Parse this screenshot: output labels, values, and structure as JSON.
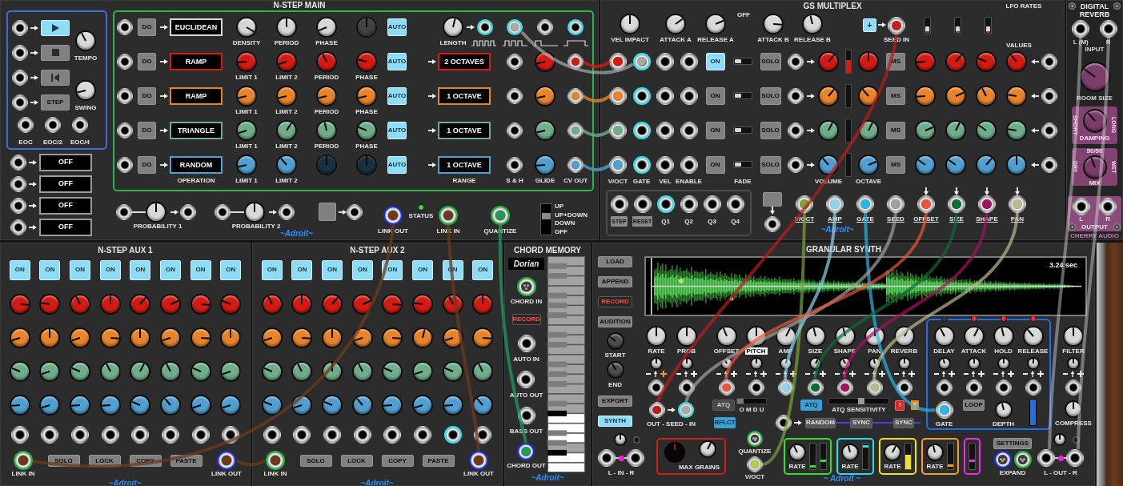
{
  "nstep_main": {
    "title": "N-STEP MAIN",
    "transport": [
      {
        "kind": "play",
        "on": true
      },
      {
        "kind": "stop",
        "on": false
      },
      {
        "kind": "rewind",
        "on": false
      },
      {
        "kind": "step",
        "label": "STEP",
        "on": false
      }
    ],
    "tempo": {
      "label": "TEMPO",
      "level": 0.4
    },
    "swing": {
      "label": "SWING",
      "level": 0.12
    },
    "clock_outputs": [
      {
        "label": "EOC"
      },
      {
        "label": "EOC/2"
      },
      {
        "label": "EOC/4"
      }
    ],
    "mode_displays": [
      {
        "value": "OFF"
      },
      {
        "value": "OFF"
      },
      {
        "value": "OFF"
      },
      {
        "value": "OFF"
      }
    ],
    "rows": [
      {
        "color": "#d6d6d6",
        "do": "DO",
        "operation": "EUCLIDEAN",
        "knobs": [
          {
            "label": "DENSITY",
            "level": 0.95,
            "disabled": false
          },
          {
            "label": "PERIOD",
            "level": 0.5,
            "disabled": false
          },
          {
            "label": "PHASE",
            "level": 0.08,
            "disabled": false
          },
          {
            "level": 0.5,
            "disabled": true
          }
        ],
        "auto": {
          "label": "AUTO",
          "on": true
        }
      },
      {
        "color": "#d41a12",
        "do": "DO",
        "operation": "RAMP",
        "knobs": [
          {
            "label": "LIMIT 1",
            "level": 0.15,
            "disabled": false
          },
          {
            "label": "LIMIT 2",
            "level": 0.1,
            "disabled": false
          },
          {
            "label": "PERIOD",
            "level": 0.4,
            "disabled": false
          },
          {
            "label": "PHASE",
            "level": 0.22,
            "disabled": false
          }
        ],
        "auto": {
          "label": "AUTO",
          "on": true
        },
        "range": "2 OCTAVES",
        "glide": {
          "level": 0.12
        },
        "cv_out": {
          "plugged": true
        }
      },
      {
        "color": "#e8832a",
        "do": "DO",
        "operation": "RAMP",
        "knobs": [
          {
            "label": "LIMIT 1",
            "level": 0.12,
            "disabled": false
          },
          {
            "label": "LIMIT 2",
            "level": 0.12,
            "disabled": false
          },
          {
            "label": "PERIOD",
            "level": 0.12,
            "disabled": false
          },
          {
            "label": "PHASE",
            "level": 0.12,
            "disabled": false
          }
        ],
        "auto": {
          "label": "AUTO",
          "on": true
        },
        "range": "1 OCTAVE",
        "glide": {
          "level": 0.12
        },
        "cv_out": {
          "plugged": true
        }
      },
      {
        "color": "#6fae8a",
        "do": "DO",
        "operation": "TRIANGLE",
        "knobs": [
          {
            "label": "LIMIT 1",
            "level": 0.1,
            "disabled": false
          },
          {
            "label": "LIMIT 2",
            "level": 0.62,
            "disabled": false
          },
          {
            "label": "PERIOD",
            "level": 0.45,
            "disabled": false
          },
          {
            "label": "PHASE",
            "level": 0.25,
            "disabled": false
          }
        ],
        "auto": {
          "label": "AUTO",
          "on": true
        },
        "range": "1 OCTAVE",
        "glide": {
          "level": 0.12
        },
        "cv_out": {
          "plugged": true
        }
      },
      {
        "color": "#4f9fd0",
        "do": "DO",
        "operation": "RANDOM",
        "knobs": [
          {
            "label": "LIMIT 1",
            "level": 0.12,
            "disabled": false
          },
          {
            "label": "LIMIT 2",
            "level": 0.35,
            "disabled": false
          },
          {
            "level": 0.5,
            "disabled": true
          },
          {
            "level": 0.5,
            "disabled": true
          }
        ],
        "auto": {
          "label": "AUTO",
          "on": true
        },
        "range": "1 OCTAVE",
        "glide": {
          "level": 0.15
        },
        "cv_out": {
          "plugged": true
        }
      }
    ],
    "length": {
      "label": "LENGTH",
      "level": 0.55
    },
    "gate_outputs": [
      {
        "highlighted": true
      },
      {
        "highlighted": true,
        "plug": {
          "color": "#a9a9a9"
        }
      },
      {
        "highlighted": false
      },
      {
        "highlighted": true
      }
    ],
    "column_labels": {
      "operation": "OPERATION",
      "range": "RANGE",
      "sample_hold": "S & H",
      "glide": "GLIDE",
      "cv_out": "CV OUT"
    },
    "probability": [
      {
        "label": "PROBABILITY 1",
        "level": 0.5
      },
      {
        "label": "PROBABILITY 2",
        "level": 0.5
      }
    ],
    "link_out": {
      "label": "LINK OUT",
      "color": "#1d2ed8",
      "plug": {
        "color": "#6b3a1c"
      }
    },
    "status": {
      "label": "STATUS",
      "on": true
    },
    "link_in": {
      "label": "LINK IN",
      "color": "#1fb53a",
      "plug": {
        "color": "#6b3a1c"
      }
    },
    "quantize": {
      "label": "QUANTIZE",
      "color": "#1fb53a",
      "plug": {
        "color": "#1f9a5a"
      }
    },
    "direction": [
      {
        "label": "UP",
        "selected": false
      },
      {
        "label": "UP+DOWN",
        "selected": true
      },
      {
        "label": "DOWN",
        "selected": false
      },
      {
        "label": "OFF",
        "selected": false
      }
    ],
    "logo": "~Adroit~"
  },
  "gs_multiplex": {
    "title": "GS MULTIPLEX",
    "top_knobs": [
      {
        "label": "VEL IMPACT",
        "level": 0.5
      },
      {
        "label": "ATTACK A",
        "level": 0.7
      },
      {
        "label": "RELEASE A",
        "level": 0.75
      }
    ],
    "fade_label": "OFF",
    "top_knobs_b": [
      {
        "label": "ATTACK B",
        "level": 0.85
      },
      {
        "label": "RELEASE B",
        "level": 0.45
      }
    ],
    "seed_button": {
      "label": "+",
      "on": true
    },
    "seed_in": {
      "label": "SEED IN",
      "plug": {
        "color": "#c42020"
      }
    },
    "lfo_rates_label": "LFO RATES",
    "values_label": "VALUES",
    "lfo_switches": [
      {
        "on": false
      },
      {
        "on": false
      },
      {
        "on": false
      }
    ],
    "rows": [
      {
        "color": "#d41a12",
        "voct": {
          "plugged": true
        },
        "gate": {
          "highlighted": true,
          "plug": {
            "color": "#a9a9a9"
          }
        },
        "on_button": {
          "label": "ON",
          "on": true
        },
        "fade": {
          "on": false
        },
        "solo": "SOLO",
        "volume": {
          "level": 0.65
        },
        "meter": {
          "level": 0.55
        },
        "octave": {
          "level": 0.5
        },
        "ms": "MS",
        "knobs": [
          {
            "level": 0.15
          },
          {
            "level": 0.65
          },
          {
            "level": 0.25
          },
          {
            "level": 0.35
          }
        ]
      },
      {
        "color": "#e8832a",
        "voct": {
          "plugged": true
        },
        "gate": {
          "highlighted": true
        },
        "on_button": {
          "label": "ON",
          "on": false
        },
        "fade": {
          "on": false
        },
        "solo": "SOLO",
        "volume": {
          "level": 0.65
        },
        "octave": {
          "level": 0.35
        },
        "ms": "MS",
        "knobs": [
          {
            "level": 0.15
          },
          {
            "level": 0.75
          },
          {
            "level": 0.4
          },
          {
            "level": 0.2
          }
        ]
      },
      {
        "color": "#6fae8a",
        "voct": {
          "plugged": true
        },
        "gate": {
          "highlighted": true
        },
        "on_button": {
          "label": "ON",
          "on": false
        },
        "fade": {
          "on": false
        },
        "solo": "SOLO",
        "volume": {
          "level": 0.6
        },
        "octave": {
          "level": 0.6
        },
        "ms": "MS",
        "knobs": [
          {
            "level": 0.75
          },
          {
            "level": 0.6
          },
          {
            "level": 0.3
          },
          {
            "level": 0.2
          }
        ]
      },
      {
        "color": "#4f9fd0",
        "voct": {
          "plugged": true
        },
        "gate": {
          "highlighted": true
        },
        "on_button": {
          "label": "ON",
          "on": false
        },
        "fade": {
          "on": false
        },
        "solo": "SOLO",
        "volume": {
          "level": 0.35
        },
        "octave": {
          "level": 0.75
        },
        "ms": "MS",
        "knobs": [
          {
            "level": 0.3
          },
          {
            "level": 0.3
          },
          {
            "level": 0.65
          },
          {
            "level": 0.5
          }
        ]
      }
    ],
    "column_labels": {
      "voct": "V/OCT",
      "gate": "GATE",
      "vel": "VEL",
      "enable": "ENABLE",
      "fade": "FADE",
      "volume": "VOLUME",
      "octave": "OCTAVE"
    },
    "clock_inputs": [
      {
        "label": "STEP",
        "kind": "boxed",
        "highlighted": false
      },
      {
        "label": "RESET",
        "kind": "boxed",
        "highlighted": false
      },
      {
        "label": "Q1",
        "kind": "plain",
        "highlighted": true
      },
      {
        "label": "Q2",
        "kind": "plain",
        "highlighted": false
      },
      {
        "label": "Q3",
        "kind": "plain",
        "highlighted": false
      },
      {
        "label": "Q4",
        "kind": "plain",
        "highlighted": false
      }
    ],
    "outputs": [
      {
        "label": "V/OCT",
        "plug": {
          "color": "#7ea23a"
        }
      },
      {
        "label": "AMP",
        "plug": {
          "color": "#8fd3ef"
        }
      },
      {
        "label": "GATE",
        "plug": {
          "color": "#29b6e8"
        }
      },
      {
        "label": "SEED",
        "plug": {
          "color": "#a0a0a0"
        }
      },
      {
        "label": "OFFSET",
        "plug": {
          "color": "#e8553a"
        }
      },
      {
        "label": "SIZE",
        "plug": {
          "color": "#0d6b35"
        }
      },
      {
        "label": "SHAPE",
        "plug": {
          "color": "#a3125f"
        }
      },
      {
        "label": "PAN",
        "plug": {
          "color": "#bdb98f"
        }
      }
    ],
    "logo": "~Adroit~"
  },
  "digital_reverb": {
    "title": "DIGITAL REVERB",
    "inputs": [
      {
        "label": "L (M)"
      },
      {
        "label": "R"
      }
    ],
    "input_label": "INPUT",
    "room_size": {
      "label": "ROOM SIZE",
      "level": 0.3
    },
    "damping": {
      "label": "DAMPING",
      "low": "SHORT",
      "high": "LONG",
      "level": 0.35
    },
    "mix": {
      "center": "50/50",
      "label": "MIX",
      "low": "DRY",
      "high": "WET",
      "level": 0.42
    },
    "outputs": [
      {
        "label": "L"
      },
      {
        "label": "R"
      }
    ],
    "output_label": "OUTPUT",
    "brand": "CHERRY AUDIO"
  },
  "aux": [
    {
      "title": "N-STEP AUX 1",
      "on_buttons": [
        {
          "label": "ON",
          "on": true
        },
        {
          "label": "ON",
          "on": true
        },
        {
          "label": "ON",
          "on": true
        },
        {
          "label": "ON",
          "on": true
        },
        {
          "label": "ON",
          "on": true
        },
        {
          "label": "ON",
          "on": true
        },
        {
          "label": "ON",
          "on": true
        },
        {
          "label": "ON",
          "on": true
        }
      ],
      "knob_rows": [
        {
          "color": "#d41a12",
          "knobs": [
            {
              "level": 0.85
            },
            {
              "level": 0.2
            },
            {
              "level": 0.4
            },
            {
              "level": 0.5
            },
            {
              "level": 0.65
            },
            {
              "level": 0.75
            },
            {
              "level": 0.85
            },
            {
              "level": 0.25
            }
          ]
        },
        {
          "color": "#e8832a",
          "knobs": [
            {
              "level": 0.1
            },
            {
              "level": 0.5
            },
            {
              "level": 0.1
            },
            {
              "level": 0.85
            },
            {
              "level": 0.5
            },
            {
              "level": 0.1
            },
            {
              "level": 0.85
            },
            {
              "level": 0.5
            }
          ]
        },
        {
          "color": "#6fae8a",
          "knobs": [
            {
              "level": 0.25
            },
            {
              "level": 0.1
            },
            {
              "level": 0.25
            },
            {
              "level": 0.4
            },
            {
              "level": 0.6
            },
            {
              "level": 0.4
            },
            {
              "level": 0.25
            },
            {
              "level": 0.1
            }
          ]
        },
        {
          "color": "#4f9fd0",
          "knobs": [
            {
              "level": 0.15
            },
            {
              "level": 0.1
            },
            {
              "level": 0.15
            },
            {
              "level": 0.15
            },
            {
              "level": 0.25
            },
            {
              "level": 0.35
            },
            {
              "level": 0.1
            },
            {
              "level": 0.1
            }
          ]
        }
      ],
      "jacks": [
        {
          "highlighted": false
        },
        {
          "highlighted": false
        },
        {
          "highlighted": false
        },
        {
          "highlighted": false
        },
        {
          "highlighted": false
        },
        {
          "highlighted": false
        },
        {
          "highlighted": false
        },
        {
          "highlighted": false
        }
      ],
      "link_in": {
        "label": "LINK IN",
        "color": "#1fb53a",
        "plug": {
          "color": "#6b3a1c"
        }
      },
      "buttons": [
        {
          "label": "SOLO"
        },
        {
          "label": "LOCK"
        },
        {
          "label": "COPY"
        },
        {
          "label": "PASTE"
        }
      ],
      "link_out": {
        "label": "LINK OUT",
        "color": "#1d2ed8",
        "plug": {
          "color": "#6b3a1c"
        }
      },
      "logo": "~Adroit~"
    },
    {
      "title": "N-STEP AUX 2",
      "on_buttons": [
        {
          "label": "ON",
          "on": true
        },
        {
          "label": "ON",
          "on": true
        },
        {
          "label": "ON",
          "on": true
        },
        {
          "label": "ON",
          "on": true
        },
        {
          "label": "ON",
          "on": true
        },
        {
          "label": "ON",
          "on": true
        },
        {
          "label": "ON",
          "on": true
        },
        {
          "label": "ON",
          "on": true
        }
      ],
      "knob_rows": [
        {
          "color": "#d41a12",
          "knobs": [
            {
              "level": 0.4
            },
            {
              "level": 0.5
            },
            {
              "level": 0.65
            },
            {
              "level": 0.75
            },
            {
              "level": 0.85
            },
            {
              "level": 0.2
            },
            {
              "level": 0.4
            },
            {
              "level": 0.5
            }
          ]
        },
        {
          "color": "#e8832a",
          "knobs": [
            {
              "level": 0.1
            },
            {
              "level": 0.85
            },
            {
              "level": 0.5
            },
            {
              "level": 0.1
            },
            {
              "level": 0.85
            },
            {
              "level": 0.55
            },
            {
              "level": 0.1
            },
            {
              "level": 0.85
            }
          ]
        },
        {
          "color": "#6fae8a",
          "knobs": [
            {
              "level": 0.25
            },
            {
              "level": 0.4
            },
            {
              "level": 0.5
            },
            {
              "level": 0.4
            },
            {
              "level": 0.25
            },
            {
              "level": 0.1
            },
            {
              "level": 0.25
            },
            {
              "level": 0.4
            }
          ]
        },
        {
          "color": "#4f9fd0",
          "knobs": [
            {
              "level": 0.25
            },
            {
              "level": 0.1
            },
            {
              "level": 0.25
            },
            {
              "level": 0.35
            },
            {
              "level": 0.15
            },
            {
              "level": 0.1
            },
            {
              "level": 0.15
            },
            {
              "level": 0.35
            }
          ]
        }
      ],
      "jacks": [
        {
          "highlighted": false
        },
        {
          "highlighted": false
        },
        {
          "highlighted": false
        },
        {
          "highlighted": false
        },
        {
          "highlighted": false
        },
        {
          "highlighted": false
        },
        {
          "highlighted": true
        },
        {
          "highlighted": false
        }
      ],
      "link_in": {
        "label": "LINK IN",
        "color": "#1fb53a",
        "plug": {
          "color": "#6b3a1c"
        }
      },
      "buttons": [
        {
          "label": "SOLO"
        },
        {
          "label": "LOCK"
        },
        {
          "label": "COPY"
        },
        {
          "label": "PASTE"
        }
      ],
      "link_out": {
        "label": "LINK OUT",
        "color": "#1d2ed8",
        "plug": {
          "color": "#6b3a1c"
        }
      },
      "logo": "~Adroit~"
    }
  ],
  "chord_memory": {
    "title": "CHORD MEMORY",
    "scale": "Dorian",
    "chord_in": {
      "label": "CHORD IN",
      "color": "#1fb53a"
    },
    "record": {
      "label": "RECORD",
      "on": false
    },
    "jacks": [
      {
        "label": "AUTO IN"
      },
      {
        "label": "AUTO OUT"
      },
      {
        "label": "BASS OUT"
      },
      {
        "label": "CHORD OUT",
        "color": "#1d2ed8",
        "plug": {
          "color": "#1f9a5a"
        }
      }
    ],
    "white_keys": [
      {
        "lit": false
      },
      {
        "lit": false
      },
      {
        "lit": false
      },
      {
        "lit": false
      },
      {
        "lit": false
      },
      {
        "lit": false
      },
      {
        "lit": false
      },
      {
        "lit": false
      },
      {
        "lit": false
      },
      {
        "lit": false
      },
      {
        "lit": false
      },
      {
        "lit": false
      },
      {
        "lit": false
      },
      {
        "lit": false
      },
      {
        "lit": false
      },
      {
        "lit": false
      },
      {
        "lit": true
      },
      {
        "lit": true
      },
      {
        "lit": true
      },
      {
        "lit": false
      },
      {
        "lit": true
      },
      {
        "lit": true
      }
    ],
    "black_keys": [
      {
        "lit": false
      },
      {
        "lit": false
      },
      {
        "lit": false
      },
      {
        "lit": false
      },
      {
        "lit": false
      },
      {
        "lit": false
      },
      {
        "lit": false
      },
      {
        "lit": false
      },
      {
        "lit": false
      },
      {
        "lit": false
      },
      {
        "lit": false
      },
      {
        "lit": true
      },
      {
        "lit": false
      },
      {
        "lit": false
      },
      {
        "lit": true
      }
    ],
    "logo": "~Adroit~"
  },
  "granular_synth": {
    "title": "GRANULAR SYNTH",
    "file_buttons": [
      {
        "label": "LOAD",
        "kind": "plain",
        "on": false
      },
      {
        "label": "APPEND",
        "kind": "plain",
        "on": false
      },
      {
        "label": "RECORD",
        "kind": "record",
        "on": false
      },
      {
        "label": "AUDITION",
        "kind": "plain",
        "on": false
      }
    ],
    "start": {
      "label": "START",
      "level": 0.3
    },
    "end": {
      "label": "END",
      "level": 0.4
    },
    "mode_buttons": [
      {
        "label": "EXPORT",
        "on": false
      },
      {
        "label": "SYNTH",
        "on": true
      }
    ],
    "sample_length": "3.24 sec",
    "params": [
      {
        "label": "RATE",
        "level": 0.5,
        "selected": false,
        "mod": {
          "level": 0.5
        },
        "mod_active": true
      },
      {
        "label": "PROB",
        "level": 0.5,
        "selected": false,
        "mod": {
          "level": 0.5
        },
        "mod_active": false
      },
      {
        "label": "OFFSET",
        "level": 0.42,
        "selected": false,
        "mod": {
          "level": 0.4
        },
        "mod_active": false,
        "plug": {
          "color": "#e8553a"
        }
      },
      {
        "label": "PITCH",
        "level": 0.5,
        "selected": true,
        "mod": {
          "level": 0.5
        },
        "mod_active": false
      },
      {
        "label": "AMP",
        "level": 0.6,
        "selected": false,
        "mod": {
          "level": 0.55
        },
        "mod_active": false,
        "plug": {
          "color": "#8fd3ef"
        }
      },
      {
        "label": "SIZE",
        "level": 0.45,
        "selected": false,
        "mod": {
          "level": 0.6
        },
        "mod_active": false,
        "plug": {
          "color": "#0d6b35"
        }
      },
      {
        "label": "SHAPE",
        "level": 0.45,
        "selected": false,
        "mod": {
          "level": 0.4
        },
        "mod_active": false,
        "plug": {
          "color": "#a3125f"
        }
      },
      {
        "label": "PAN",
        "level": 0.5,
        "selected": false,
        "mod": {
          "level": 0.45
        },
        "mod_active": false,
        "plug": {
          "color": "#bdb98f"
        }
      },
      {
        "label": "REVERB",
        "level": 0.6,
        "selected": false,
        "mod": {
          "level": 0.5
        },
        "mod_active": false
      }
    ],
    "envelope": [
      {
        "label": "DELAY",
        "level": 0.4,
        "led": false,
        "mod": {
          "level": 0.45
        }
      },
      {
        "label": "ATTACK",
        "level": 0.6,
        "led": true,
        "mod": {
          "level": 0.5
        }
      },
      {
        "label": "HOLD",
        "level": 0.45,
        "led": true,
        "mod": {
          "level": 0.5
        }
      },
      {
        "label": "RELEASE",
        "level": 0.35,
        "led": true,
        "mod": {
          "level": 0.5
        }
      }
    ],
    "gate": {
      "label": "GATE",
      "plug": {
        "color": "#29b6e8"
      }
    },
    "loop": {
      "label": "LOOP",
      "on": false
    },
    "depth": {
      "label": "DEPTH",
      "level": 0.45
    },
    "envelope_meter": {
      "level": 1
    },
    "filter": {
      "label": "FILTER",
      "level": 0.5,
      "mod": {
        "level": 0.5
      }
    },
    "compress": {
      "label": "COMPRESS",
      "level": 0.5
    },
    "seed": {
      "label": "OUT - SEED - IN",
      "out_plug": {
        "color": "#b81c1c"
      },
      "in_plug": {
        "color": "#a9a9a9"
      },
      "in_highlighted": true
    },
    "atq_left": {
      "label": "ATQ",
      "on": false
    },
    "reflect": {
      "label": "RFLCT",
      "on": true
    },
    "mode_switch": {
      "label": "O M D U",
      "level": 0
    },
    "atq": {
      "label": "ATQ",
      "on": true
    },
    "atq_sensitivity": {
      "label": "ATQ SENSITIVITY",
      "level": 0.55
    },
    "alert": {
      "label": "!"
    },
    "random": {
      "label": "RANDOM"
    },
    "sync": [
      {
        "label": "SYNC"
      },
      {
        "label": "SYNC"
      }
    ],
    "lfos": [
      {
        "color": "#2fe02f",
        "knob": {
          "label": "RATE",
          "level": 0.4
        },
        "sliders": [
          {
            "kind": "marker",
            "level": 0.08
          },
          {
            "kind": "marker",
            "level": 0.3
          }
        ]
      },
      {
        "color": "#27dbe8",
        "knob": {
          "label": "RATE",
          "level": 0.45
        },
        "sliders": [
          {
            "kind": "marker",
            "level": 0.92
          }
        ]
      },
      {
        "color": "#f2e21c",
        "knob": {
          "label": "RATE",
          "level": 0.6
        },
        "sliders": [
          {
            "kind": "fill",
            "level": 0.55
          }
        ]
      },
      {
        "color": "#f2a22a",
        "knob": {
          "label": "RATE",
          "level": 0.45
        },
        "sliders": [
          {
            "kind": "marker",
            "level": 0.12
          }
        ]
      },
      {
        "color": "#ee2cee",
        "sliders": [
          {
            "kind": "marker",
            "level": 0.3
          }
        ]
      }
    ],
    "settings": {
      "label": "SETTINGS"
    },
    "expand": {
      "label": "EXPAND"
    },
    "input": {
      "label": "L - IN - R",
      "level": 0.5
    },
    "max_grains": {
      "label": "MAX GRAINS",
      "level": 0.6
    },
    "quantize": {
      "label": "QUANTIZE",
      "color": "#1fb53a"
    },
    "voct": {
      "label": "V/OCT",
      "plug": {
        "color": "#a6d646"
      }
    },
    "output": {
      "label": "L - OUT - R",
      "level": 0.5
    },
    "logo": "~ Adroit ~"
  }
}
